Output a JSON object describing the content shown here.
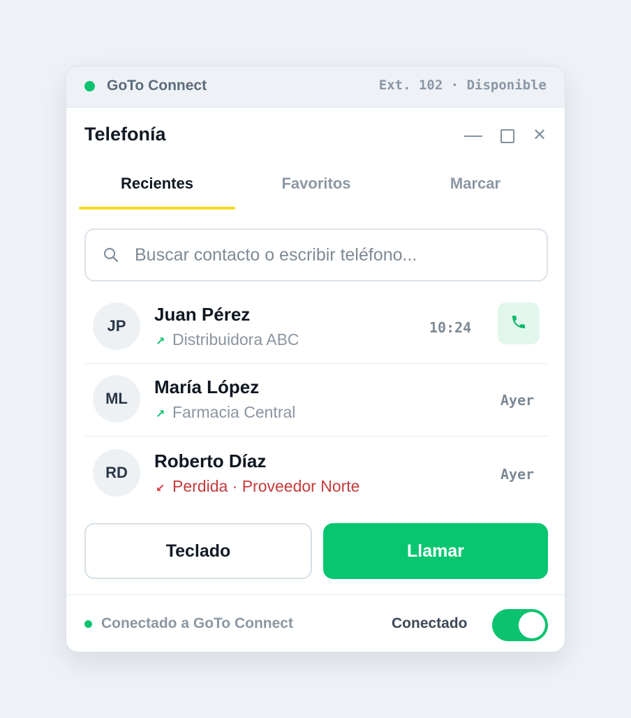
{
  "topbar": {
    "app_name": "GoTo Connect",
    "ext_status": "Ext. 102 · Disponible",
    "status_color": "#0bc36f"
  },
  "window": {
    "title": "Telefonía",
    "controls": [
      "minimize-icon",
      "maximize-icon",
      "close-icon"
    ]
  },
  "tabs": [
    {
      "label": "Recientes",
      "active": true
    },
    {
      "label": "Favoritos",
      "active": false
    },
    {
      "label": "Marcar",
      "active": false
    }
  ],
  "search": {
    "placeholder": "Buscar contacto o escribir teléfono...",
    "value": ""
  },
  "contacts": [
    {
      "initials": "JP",
      "name": "Juan Pérez",
      "direction": "outgoing",
      "detail": "Distribuidora ABC",
      "time": "10:24",
      "missed": false
    },
    {
      "initials": "ML",
      "name": "María López",
      "direction": "outgoing",
      "detail": "Farmacia Central",
      "time": "Ayer",
      "missed": false
    },
    {
      "initials": "RD",
      "name": "Roberto Díaz",
      "direction": "incoming-missed",
      "detail": "Perdida · Proveedor Norte",
      "time": "Ayer",
      "missed": true
    }
  ],
  "actions": {
    "keypad_label": "Teclado",
    "call_label": "Llamar"
  },
  "footer": {
    "connection_text": "Conectado a GoTo Connect",
    "toggle_label": "Conectado",
    "toggle_on": true
  },
  "colors": {
    "accent_green": "#08c670",
    "tab_underline": "#f7da1e",
    "missed_red": "#c53a3a"
  }
}
